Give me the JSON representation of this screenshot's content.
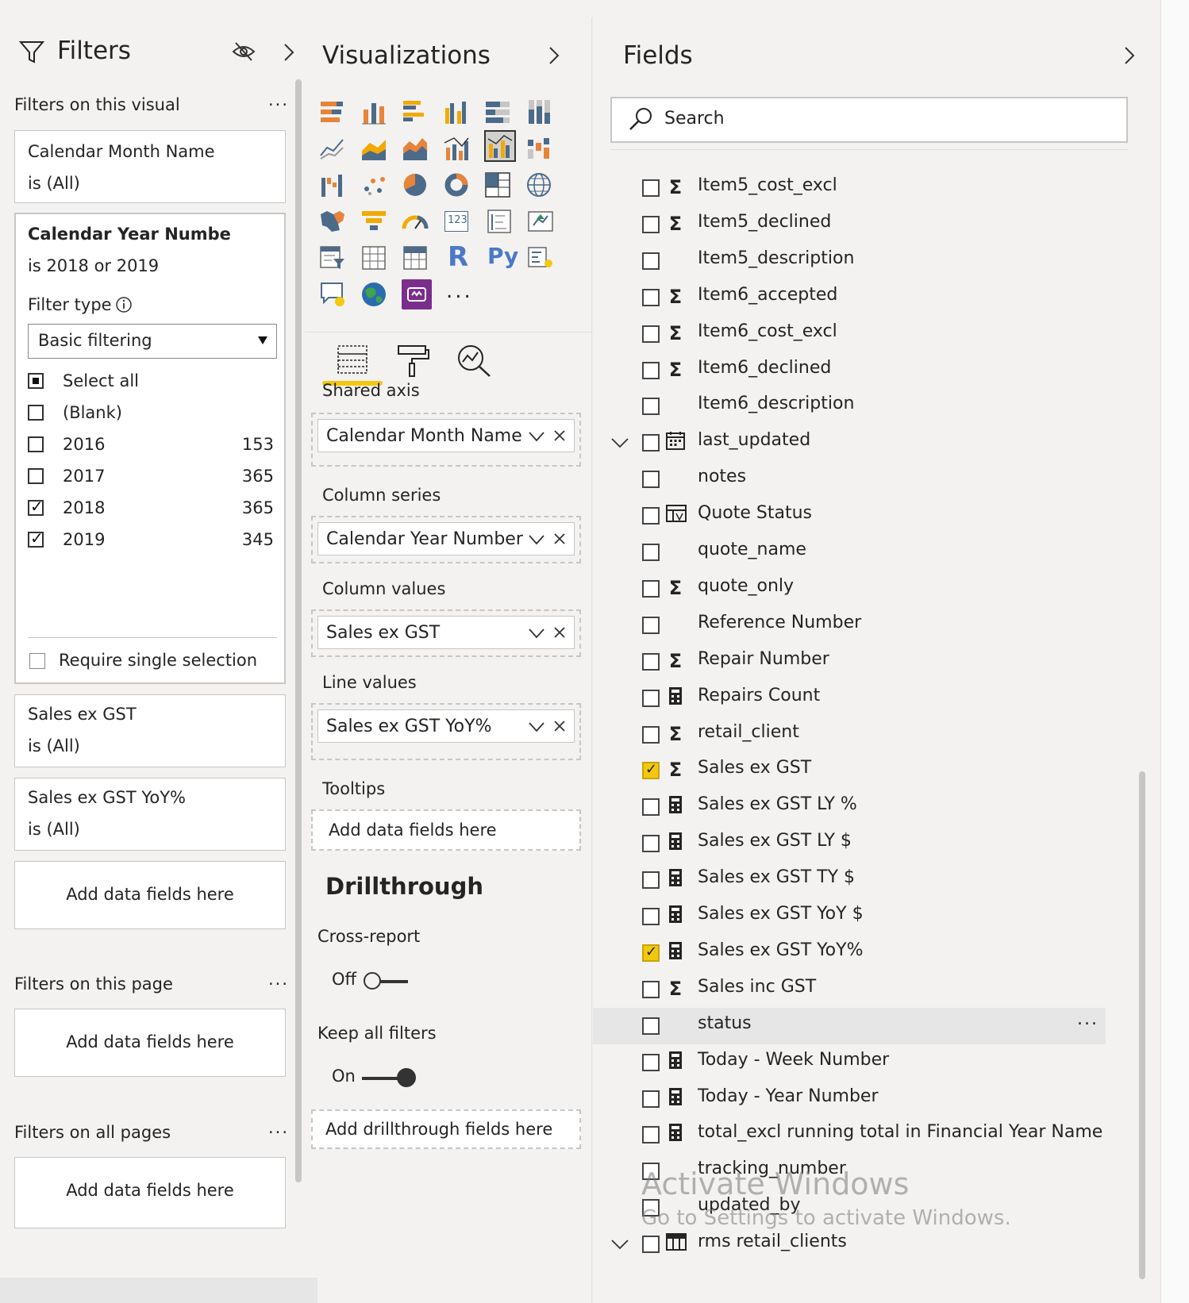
{
  "filters_pane": {
    "title": "Filters",
    "visual_section": "Filters on this visual",
    "more": "...",
    "cards": [
      {
        "field": "Calendar Month Name",
        "state": "is (All)"
      },
      {
        "field": "Calendar Year Numbe",
        "state": "is 2018 or 2019"
      },
      {
        "field": "Sales ex GST",
        "state": "is (All)"
      },
      {
        "field": "Sales ex GST YoY%",
        "state": "is (All)"
      }
    ],
    "filter_type_label": "Filter type",
    "filter_type_value": "Basic filtering",
    "options": [
      {
        "label": "Select all",
        "count": "",
        "checked": "partial"
      },
      {
        "label": "(Blank)",
        "count": "",
        "checked": "no"
      },
      {
        "label": "2016",
        "count": "153",
        "checked": "no"
      },
      {
        "label": "2017",
        "count": "365",
        "checked": "no"
      },
      {
        "label": "2018",
        "count": "365",
        "checked": "yes"
      },
      {
        "label": "2019",
        "count": "345",
        "checked": "yes"
      }
    ],
    "require_single": "Require single selection",
    "add_fields": "Add data fields here",
    "page_section": "Filters on this page",
    "all_pages_section": "Filters on all pages"
  },
  "viz_pane": {
    "title": "Visualizations",
    "shared_axis": "Shared axis",
    "shared_axis_value": "Calendar Month Name",
    "column_series": "Column series",
    "column_series_value": "Calendar Year Number",
    "column_values": "Column values",
    "column_values_value": "Sales ex GST",
    "line_values": "Line values",
    "line_values_value": "Sales ex GST YoY%",
    "tooltips": "Tooltips",
    "tooltips_placeholder": "Add data fields here",
    "drillthrough": "Drillthrough",
    "cross_report": "Cross-report",
    "cross_report_state": "Off",
    "keep_filters": "Keep all filters",
    "keep_filters_state": "On",
    "drill_placeholder": "Add drillthrough fields here",
    "more_visuals": "...",
    "r_glyph": "R",
    "py_glyph": "Py",
    "card_glyph": "123",
    "accent": "#f2c811"
  },
  "fields_pane": {
    "title": "Fields",
    "search_placeholder": "Search",
    "accent": "#f2c811",
    "rows": [
      {
        "name": "Item5_cost_excl",
        "icon": "sigma",
        "checked": false
      },
      {
        "name": "Item5_declined",
        "icon": "sigma",
        "checked": false
      },
      {
        "name": "Item5_description",
        "icon": "none",
        "checked": false
      },
      {
        "name": "Item6_accepted",
        "icon": "sigma",
        "checked": false
      },
      {
        "name": "Item6_cost_excl",
        "icon": "sigma",
        "checked": false
      },
      {
        "name": "Item6_declined",
        "icon": "sigma",
        "checked": false
      },
      {
        "name": "Item6_description",
        "icon": "none",
        "checked": false
      },
      {
        "name": "last_updated",
        "icon": "calendar",
        "checked": false,
        "expandable": true
      },
      {
        "name": "notes",
        "icon": "none",
        "checked": false
      },
      {
        "name": "Quote Status",
        "icon": "hierarchy",
        "checked": false
      },
      {
        "name": "quote_name",
        "icon": "none",
        "checked": false
      },
      {
        "name": "quote_only",
        "icon": "sigma",
        "checked": false
      },
      {
        "name": "Reference Number",
        "icon": "none",
        "checked": false
      },
      {
        "name": "Repair Number",
        "icon": "sigma",
        "checked": false
      },
      {
        "name": "Repairs Count",
        "icon": "calc",
        "checked": false
      },
      {
        "name": "retail_client",
        "icon": "sigma",
        "checked": false
      },
      {
        "name": "Sales ex GST",
        "icon": "sigma",
        "checked": true
      },
      {
        "name": "Sales ex GST LY %",
        "icon": "calc",
        "checked": false
      },
      {
        "name": "Sales ex GST LY $",
        "icon": "calc",
        "checked": false
      },
      {
        "name": "Sales ex GST TY $",
        "icon": "calc",
        "checked": false
      },
      {
        "name": "Sales ex GST YoY $",
        "icon": "calc",
        "checked": false
      },
      {
        "name": "Sales ex GST YoY%",
        "icon": "calc",
        "checked": true
      },
      {
        "name": "Sales inc GST",
        "icon": "sigma",
        "checked": false
      },
      {
        "name": "status",
        "icon": "none",
        "checked": false,
        "hovered": true
      },
      {
        "name": "Today - Week Number",
        "icon": "calc",
        "checked": false
      },
      {
        "name": "Today - Year Number",
        "icon": "calc",
        "checked": false
      },
      {
        "name": "total_excl running total in Financial Year Name",
        "icon": "calc",
        "checked": false
      },
      {
        "name": "tracking_number",
        "icon": "none",
        "checked": false
      },
      {
        "name": "updated_by",
        "icon": "none",
        "checked": false
      },
      {
        "name": "rms retail_clients",
        "icon": "table",
        "checked": false,
        "expandable": true
      }
    ],
    "row_more": "..."
  },
  "watermark": {
    "line1": "Activate Windows",
    "line2": "Go to Settings to activate Windows."
  }
}
